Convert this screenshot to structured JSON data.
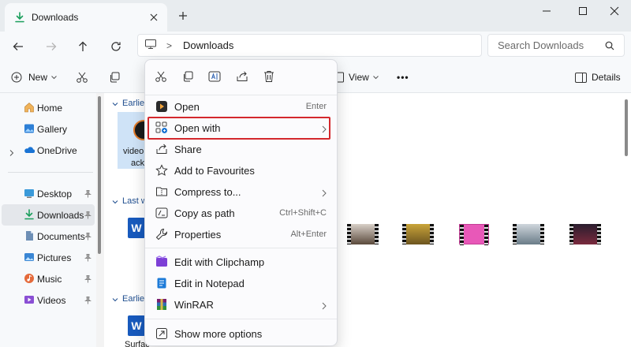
{
  "window": {
    "tab_title": "Downloads",
    "new_tab_glyph": "+"
  },
  "address_bar": {
    "crumb": "Downloads",
    "separator": ">"
  },
  "search": {
    "placeholder": "Search Downloads"
  },
  "toolbar": {
    "new_label": "New",
    "view_label": "View",
    "more_label": "•••",
    "details_label": "Details"
  },
  "sidebar": {
    "items": [
      {
        "label": "Home",
        "icon": "home-icon"
      },
      {
        "label": "Gallery",
        "icon": "gallery-icon"
      },
      {
        "label": "OneDrive",
        "icon": "onedrive-icon"
      },
      {
        "label": "Desktop",
        "icon": "desktop-icon"
      },
      {
        "label": "Downloads",
        "icon": "download-icon"
      },
      {
        "label": "Documents",
        "icon": "documents-icon"
      },
      {
        "label": "Pictures",
        "icon": "pictures-icon"
      },
      {
        "label": "Music",
        "icon": "music-icon"
      },
      {
        "label": "Videos",
        "icon": "videos-icon"
      }
    ]
  },
  "content": {
    "groups": [
      "Earlie",
      "Last w",
      "Earlie"
    ],
    "selected_file_label_1": "video",
    "selected_file_label_2": "ack",
    "word_letter": "W",
    "bottom_file_label": "Surfac"
  },
  "context_menu": {
    "quick_actions": [
      "cut-icon",
      "copy-icon",
      "rename-icon",
      "share-icon",
      "delete-icon"
    ],
    "items": [
      {
        "label": "Open",
        "shortcut": "Enter",
        "icon": "play-app-icon"
      },
      {
        "label": "Open with",
        "shortcut": "",
        "icon": "open-with-icon",
        "submenu": true
      },
      {
        "label": "Share",
        "shortcut": "",
        "icon": "share-icon"
      },
      {
        "label": "Add to Favourites",
        "shortcut": "",
        "icon": "star-icon"
      },
      {
        "label": "Compress to...",
        "shortcut": "",
        "icon": "compress-icon",
        "submenu": true
      },
      {
        "label": "Copy as path",
        "shortcut": "Ctrl+Shift+C",
        "icon": "copy-path-icon"
      },
      {
        "label": "Properties",
        "shortcut": "Alt+Enter",
        "icon": "wrench-icon"
      },
      {
        "label": "Edit with Clipchamp",
        "shortcut": "",
        "icon": "clipchamp-icon"
      },
      {
        "label": "Edit in Notepad",
        "shortcut": "",
        "icon": "notepad-icon"
      },
      {
        "label": "WinRAR",
        "shortcut": "",
        "icon": "winrar-icon",
        "submenu": true
      },
      {
        "label": "Show more options",
        "shortcut": "",
        "icon": "more-options-icon"
      }
    ],
    "highlighted_item": "Open with"
  },
  "colors": {
    "accent": "#0067c0",
    "highlight_box": "#d4282d",
    "download_green": "#1a9e5c"
  }
}
